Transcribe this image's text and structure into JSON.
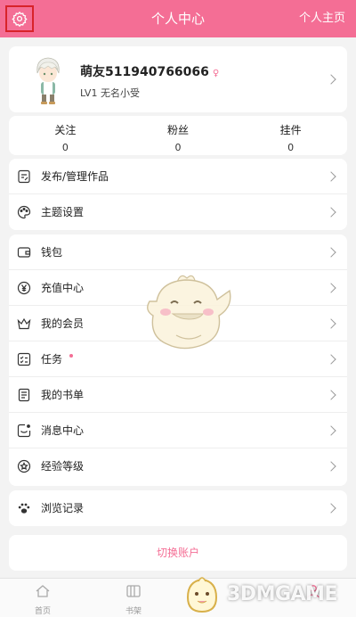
{
  "header": {
    "title": "个人中心",
    "home_link": "个人主页",
    "accent": "#f46e95"
  },
  "profile": {
    "name": "萌友511940766066",
    "gender_symbol": "♀",
    "level": "LV1 无名小受"
  },
  "stats": [
    {
      "label": "关注",
      "value": "0"
    },
    {
      "label": "粉丝",
      "value": "0"
    },
    {
      "label": "挂件",
      "value": "0"
    }
  ],
  "menu_group_1": [
    {
      "label": "发布/管理作品",
      "icon": "edit-document-icon"
    },
    {
      "label": "主题设置",
      "icon": "palette-icon"
    }
  ],
  "menu_group_2": [
    {
      "label": "钱包",
      "icon": "wallet-icon"
    },
    {
      "label": "充值中心",
      "icon": "yen-coin-icon"
    },
    {
      "label": "我的会员",
      "icon": "crown-icon"
    },
    {
      "label": "任务",
      "icon": "task-list-icon",
      "badge": true
    },
    {
      "label": "我的书单",
      "icon": "booklist-icon"
    },
    {
      "label": "消息中心",
      "icon": "message-icon"
    },
    {
      "label": "经验等级",
      "icon": "experience-badge-icon"
    }
  ],
  "menu_group_3": [
    {
      "label": "浏览记录",
      "icon": "paw-history-icon"
    }
  ],
  "switch_account": "切换账户",
  "tabbar": [
    {
      "label": "首页",
      "icon": "home-icon"
    },
    {
      "label": "书架",
      "icon": "bookshelf-icon"
    }
  ],
  "watermark": "3DMGAME"
}
